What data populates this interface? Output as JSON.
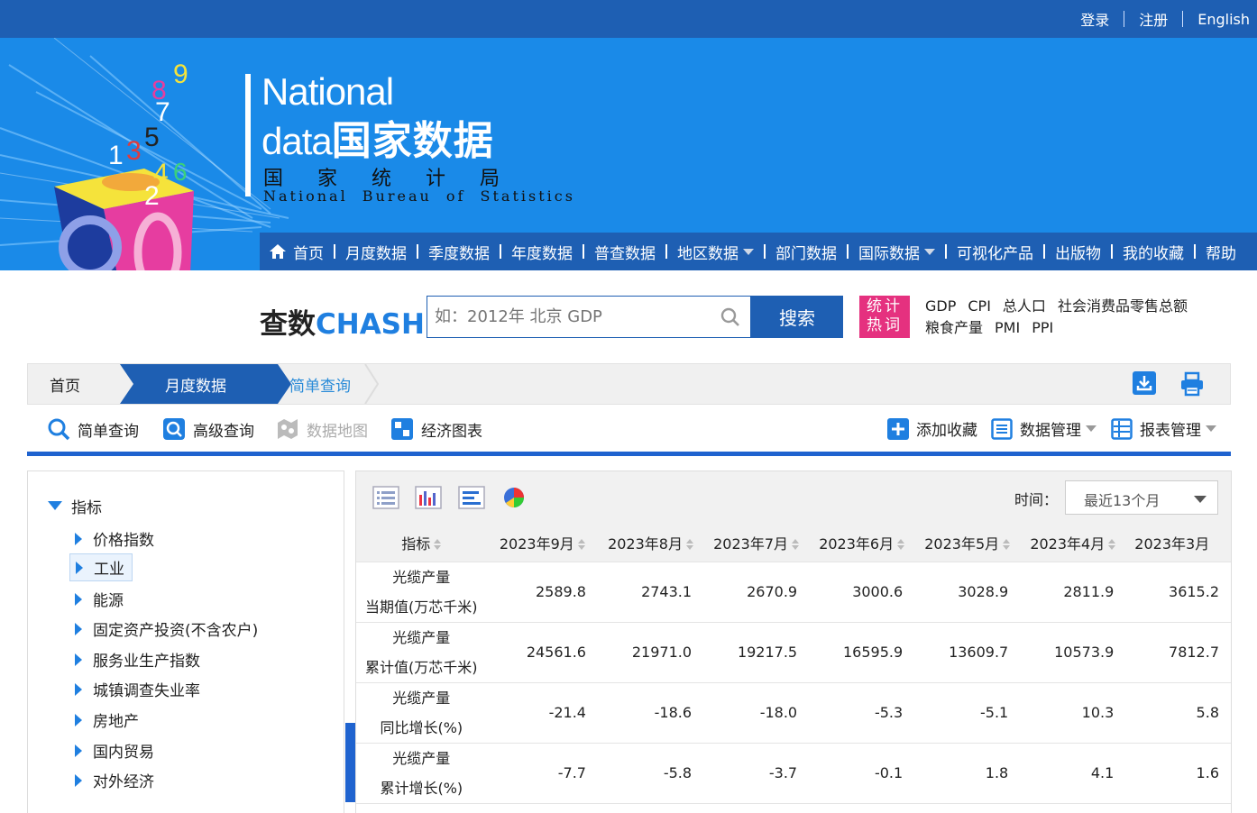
{
  "topbar": {
    "login": "登录",
    "register": "注册",
    "english": "English"
  },
  "logo": {
    "line1": "National",
    "line2_en": "data",
    "line2_cn": "国家数据",
    "line3": "国家统计局",
    "line4": "National Bureau of Statistics"
  },
  "nav": {
    "home": "首页",
    "items": [
      "月度数据",
      "季度数据",
      "年度数据",
      "普查数据",
      "地区数据",
      "部门数据",
      "国际数据",
      "可视化产品",
      "出版物",
      "我的收藏",
      "帮助"
    ]
  },
  "search": {
    "brand_cn": "查数",
    "brand_en": "CHASHU",
    "placeholder": "如：2012年 北京 GDP",
    "button": "搜索",
    "hot_label_1": "统计",
    "hot_label_2": "热词",
    "hot_row1": [
      "GDP",
      "CPI",
      "总人口",
      "社会消费品零售总额"
    ],
    "hot_row2": [
      "粮食产量",
      "PMI",
      "PPI"
    ]
  },
  "breadcrumb": {
    "c0": "首页",
    "c1": "月度数据",
    "c2": "简单查询"
  },
  "tools": {
    "simple": "简单查询",
    "advanced": "高级查询",
    "map": "数据地图",
    "chart": "经济图表",
    "fav": "添加收藏",
    "datamgmt": "数据管理",
    "report": "报表管理"
  },
  "tree": {
    "root": "指标",
    "nodes": [
      "价格指数",
      "工业",
      "能源",
      "固定资产投资(不含农户)",
      "服务业生产指数",
      "城镇调查失业率",
      "房地产",
      "国内贸易",
      "对外经济"
    ]
  },
  "filter": {
    "time_label": "时间：",
    "time_value": "最近13个月"
  },
  "table": {
    "headers": [
      "指标",
      "2023年9月",
      "2023年8月",
      "2023年7月",
      "2023年6月",
      "2023年5月",
      "2023年4月",
      "2023年3月"
    ],
    "rows": [
      {
        "name1": "光缆产量",
        "name2": "当期值(万芯千米)",
        "values": [
          "2589.8",
          "2743.1",
          "2670.9",
          "3000.6",
          "3028.9",
          "2811.9",
          "3615.2"
        ]
      },
      {
        "name1": "光缆产量",
        "name2": "累计值(万芯千米)",
        "values": [
          "24561.6",
          "21971.0",
          "19217.5",
          "16595.9",
          "13609.7",
          "10573.9",
          "7812.7"
        ]
      },
      {
        "name1": "光缆产量",
        "name2": "同比增长(%)",
        "values": [
          "-21.4",
          "-18.6",
          "-18.0",
          "-5.3",
          "-5.1",
          "10.3",
          "5.8"
        ]
      },
      {
        "name1": "光缆产量",
        "name2": "累计增长(%)",
        "values": [
          "-7.7",
          "-5.8",
          "-3.7",
          "-0.1",
          "1.8",
          "4.1",
          "1.6"
        ]
      }
    ]
  },
  "colors": {
    "nav_blue": "#1e5fb3",
    "banner_blue": "#1a8ae8",
    "hot_pink": "#e5317f",
    "accent": "#1f7fe0"
  }
}
